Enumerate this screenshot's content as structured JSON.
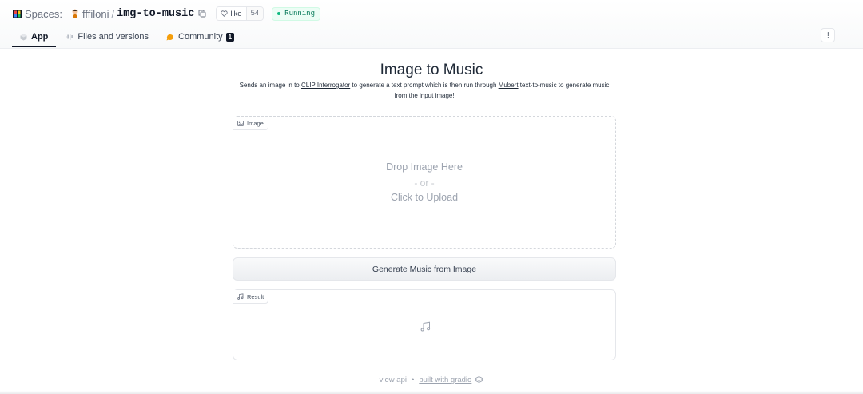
{
  "header": {
    "spaces_label": "Spaces:",
    "owner": "fffiloni",
    "separator": "/",
    "repo_name": "img-to-music",
    "like_label": "like",
    "like_count": "54",
    "status": "Running",
    "status_color": "#10b981"
  },
  "tabs": [
    {
      "label": "App",
      "icon": "app-icon",
      "active": true
    },
    {
      "label": "Files and versions",
      "icon": "files-icon",
      "active": false
    },
    {
      "label": "Community",
      "icon": "community-icon",
      "active": false,
      "count": "1"
    }
  ],
  "main": {
    "title": "Image to Music",
    "description": {
      "part1": "Sends an image in to ",
      "link1": "CLIP Interrogator",
      "part2": " to generate a text prompt which is then run through ",
      "link2": "Mubert",
      "part3": " text-to-music to generate music from the input image!"
    },
    "image_input": {
      "label": "Image",
      "drop_text": "Drop Image Here",
      "or_text": "- or -",
      "upload_text": "Click to Upload"
    },
    "generate_button": "Generate Music from Image",
    "result": {
      "label": "Result",
      "icon": "music-note-icon"
    }
  },
  "footer": {
    "view_api": "view api",
    "separator": "•",
    "built_with": "built with gradio"
  }
}
